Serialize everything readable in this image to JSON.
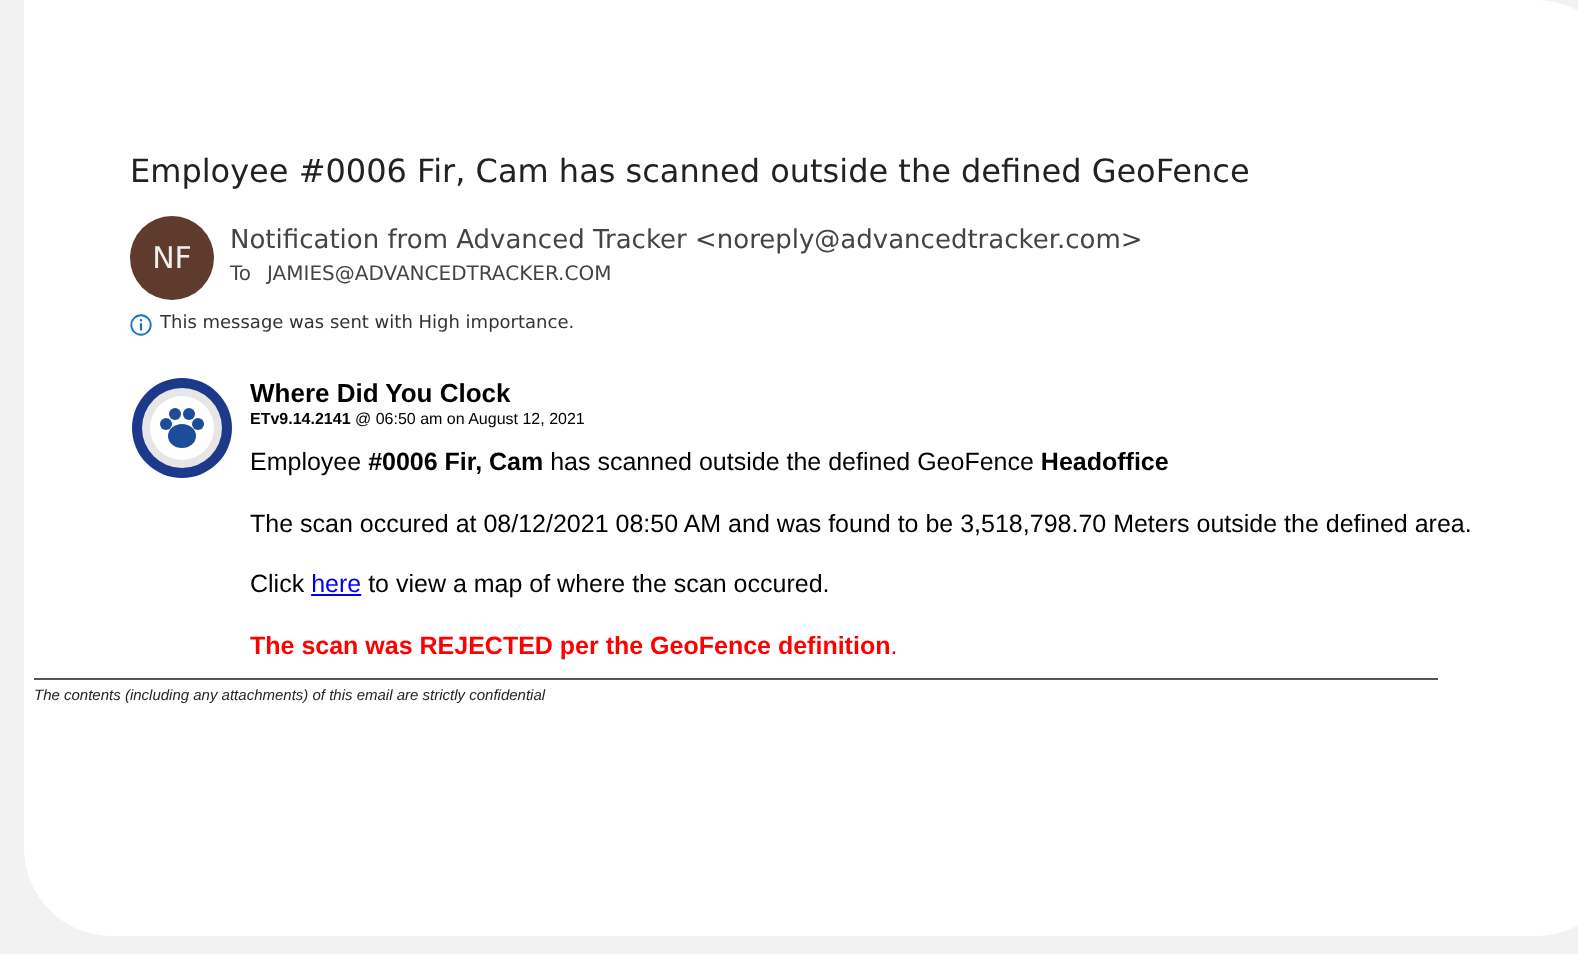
{
  "subject": "Employee #0006 Fir, Cam has scanned outside the defined GeoFence",
  "sender": {
    "initials": "NF",
    "from": "Notification from Advanced Tracker <noreply@advancedtracker.com>",
    "to_label": "To",
    "to": "JAMIES@ADVANCEDTRACKER.COM"
  },
  "importance_note": "This message was sent with High importance.",
  "body": {
    "app_name": "Where Did You Clock",
    "version_line": "**ETv9.14.2141** @ 06:50 am on August 12, 2021",
    "paragraphs": [
      {
        "kind": "text",
        "text": "Employee **#0006 Fir, Cam** has scanned outside the defined GeoFence **Headoffice**"
      },
      {
        "kind": "text",
        "text": "The scan occured at 08/12/2021 08:50 AM and was found to be 3,518,798.70 Meters outside the defined area."
      },
      {
        "kind": "link",
        "before": "Click ",
        "link": "here",
        "after": " to view a map of where the scan occured."
      },
      {
        "kind": "alert",
        "text": "**The scan was REJECTED per the GeoFence definition**."
      }
    ]
  },
  "footer": "The contents (including any attachments) of this email are strictly confidential"
}
